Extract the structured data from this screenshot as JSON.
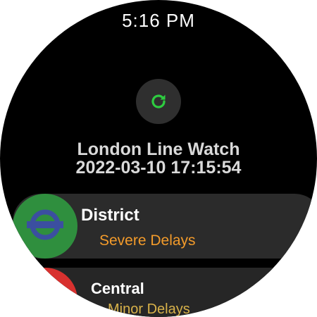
{
  "status_bar": {
    "time": "5:16 PM"
  },
  "header": {
    "refresh_icon": "refresh-icon",
    "title": "London Line Watch",
    "timestamp": "2022-03-10 17:15:54"
  },
  "colors": {
    "refresh_accent": "#2ecc40",
    "severe_delays": "#f39b2b",
    "minor_delays": "#d8b24a",
    "district_line": "#2f8f3e",
    "central_line": "#d8312f",
    "roundel_blue": "#3b4fa0"
  },
  "lines": [
    {
      "name": "District",
      "status": "Severe Delays",
      "icon": "tfl-roundel-icon"
    },
    {
      "name": "Central",
      "status": "Minor Delays",
      "icon": "tfl-roundel-icon"
    }
  ]
}
